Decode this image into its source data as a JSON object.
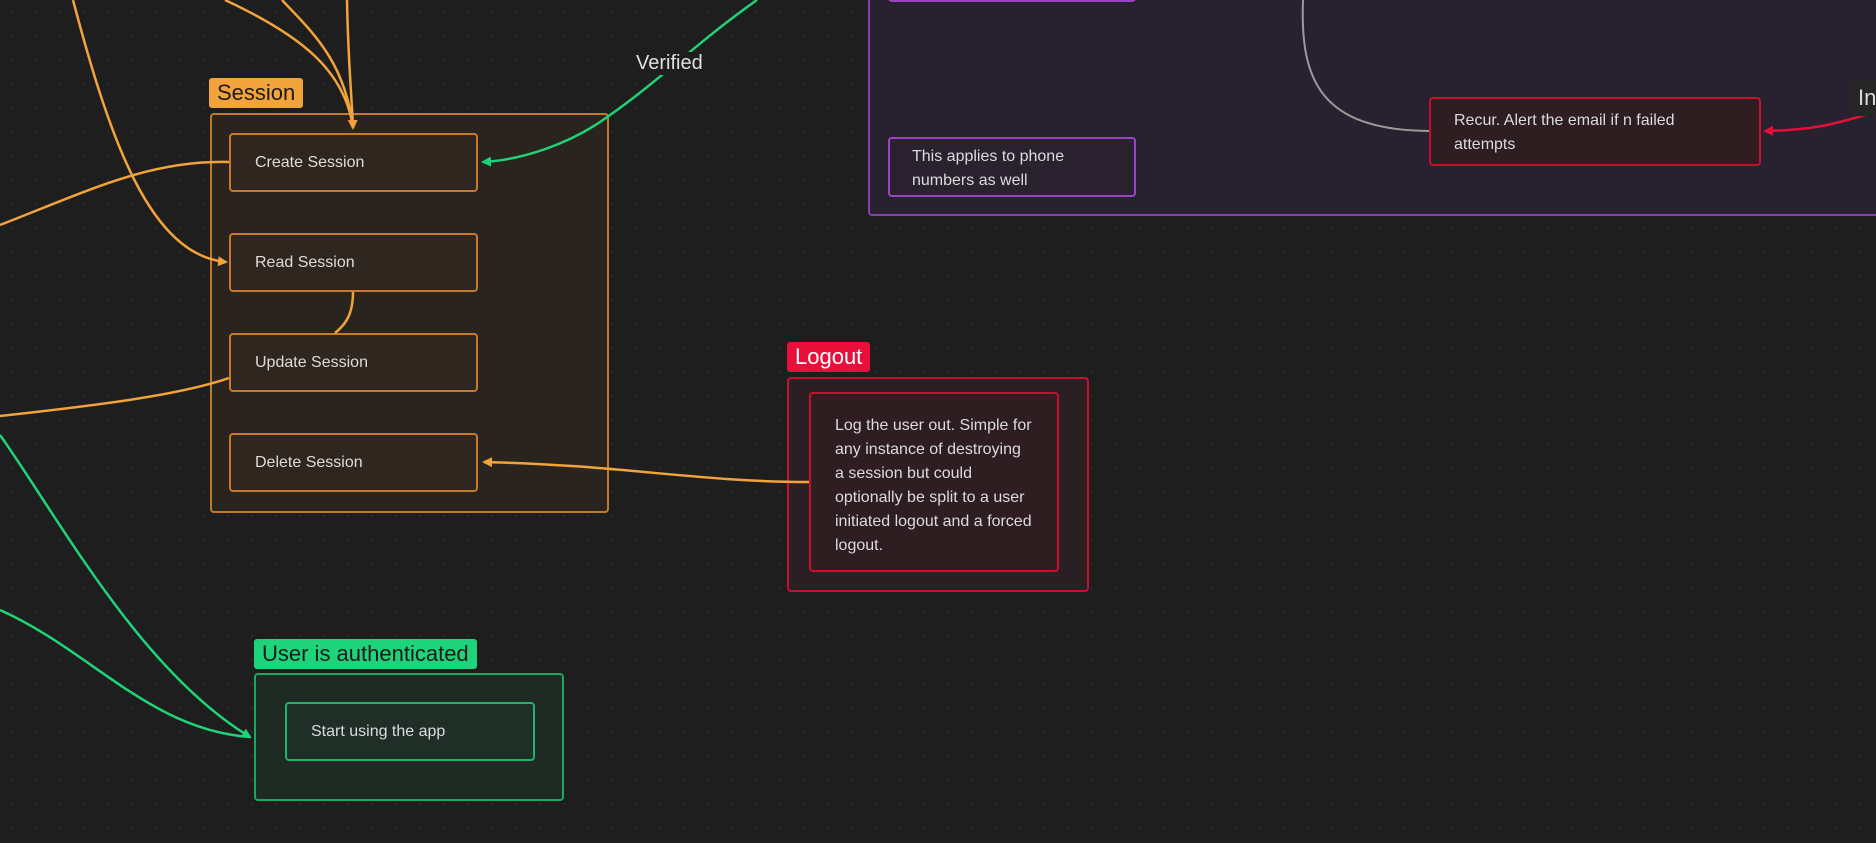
{
  "colors": {
    "background": "#1e1e1e",
    "orange": "#f2a33a",
    "green": "#1fd37a",
    "red": "#e8103a",
    "purple": "#9a45c4",
    "gray": "#9a9a9a"
  },
  "groups": {
    "session": {
      "label": "Session",
      "nodes": {
        "create": "Create Session",
        "read": "Read Session",
        "update": "Update Session",
        "delete": "Delete Session"
      }
    },
    "logout": {
      "label": "Logout",
      "node": "Log the user out. Simple for any instance of destroying a session but could optionally be split to a user initiated logout and a forced logout."
    },
    "authenticated": {
      "label": "User is authenticated",
      "node": "Start using the app"
    },
    "email": {
      "phone_note": "This applies to phone numbers as well",
      "recur_note": "Recur. Alert the email if n failed attempts",
      "peek_label": "In"
    }
  },
  "edge_labels": {
    "verified": "Verified"
  }
}
